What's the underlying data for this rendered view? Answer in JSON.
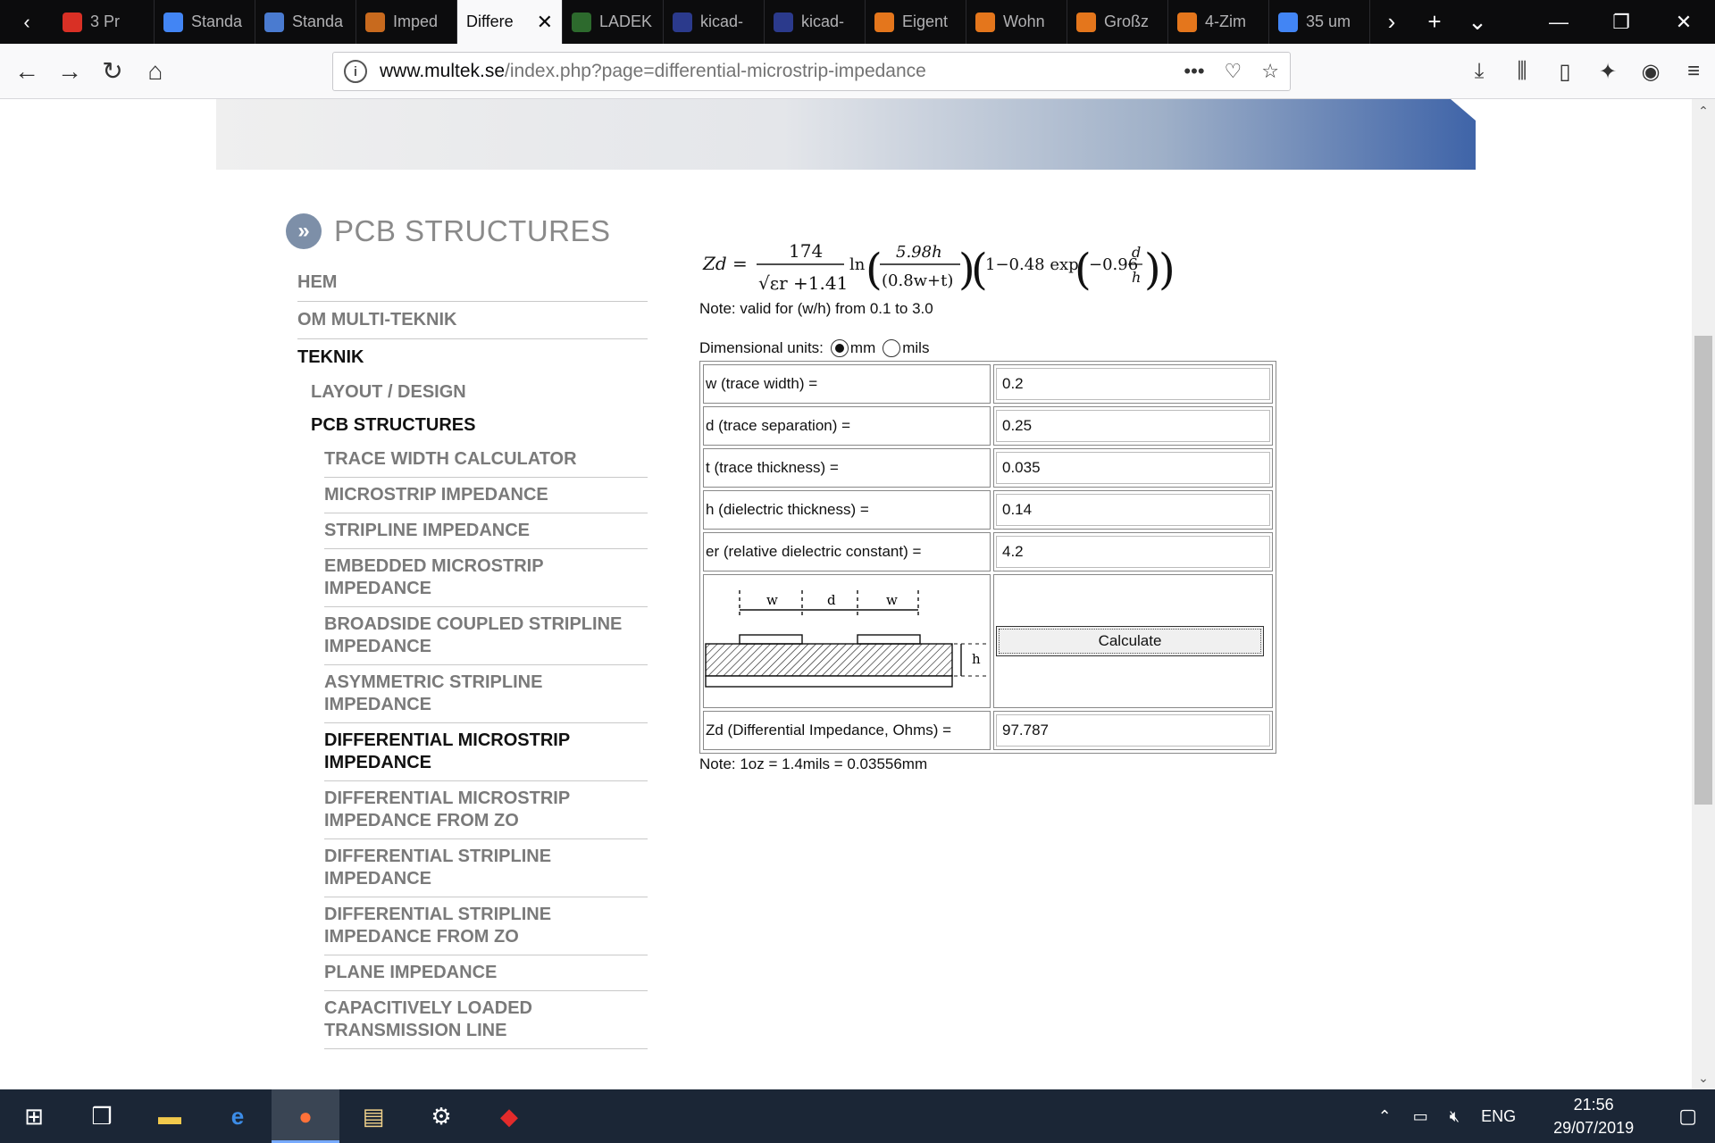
{
  "browser": {
    "tabs": [
      {
        "title": "3 Pr",
        "icon": "gmail-icon",
        "color": "#d93025"
      },
      {
        "title": "Standa",
        "icon": "google-icon",
        "color": "#4285f4"
      },
      {
        "title": "Standa",
        "icon": "globe-icon",
        "color": "#4a7bd0"
      },
      {
        "title": "Imped",
        "icon": "gear-favicon-icon",
        "color": "#c86a1e"
      },
      {
        "title": "Differe",
        "icon": "",
        "color": ""
      },
      {
        "title": "LADEK",
        "icon": "ladek-icon",
        "color": "#2d6a2d"
      },
      {
        "title": "kicad-",
        "icon": "kicad-icon",
        "color": "#2b3a8c"
      },
      {
        "title": "kicad-",
        "icon": "kicad-icon",
        "color": "#2b3a8c"
      },
      {
        "title": "Eigent",
        "icon": "house-icon",
        "color": "#e4761c"
      },
      {
        "title": "Wohn",
        "icon": "house-icon",
        "color": "#e4761c"
      },
      {
        "title": "Großz",
        "icon": "house-icon",
        "color": "#e4761c"
      },
      {
        "title": "4-Zim",
        "icon": "house-icon",
        "color": "#e4761c"
      },
      {
        "title": "35 um",
        "icon": "google-icon",
        "color": "#4285f4"
      }
    ],
    "url_host": "www.multek.se",
    "url_path": "/index.php?page=differential-microstrip-impedance"
  },
  "page": {
    "section_title": "PCB STRUCTURES",
    "menu": [
      {
        "label": "HEM",
        "level": 1,
        "current": false
      },
      {
        "label": "OM MULTI-TEKNIK",
        "level": 1,
        "current": false
      },
      {
        "label": "TEKNIK",
        "level": 1,
        "current": true
      },
      {
        "label": "LAYOUT / DESIGN",
        "level": 2,
        "current": false
      },
      {
        "label": "PCB STRUCTURES",
        "level": 2,
        "current": true
      },
      {
        "label": "TRACE WIDTH CALCULATOR",
        "level": 3,
        "current": false
      },
      {
        "label": "MICROSTRIP IMPEDANCE",
        "level": 3,
        "current": false
      },
      {
        "label": "STRIPLINE IMPEDANCE",
        "level": 3,
        "current": false
      },
      {
        "label": "EMBEDDED MICROSTRIP IMPEDANCE",
        "level": 3,
        "current": false
      },
      {
        "label": "BROADSIDE COUPLED STRIPLINE IMPEDANCE",
        "level": 3,
        "current": false
      },
      {
        "label": "ASYMMETRIC STRIPLINE IMPEDANCE",
        "level": 3,
        "current": false
      },
      {
        "label": "DIFFERENTIAL MICROSTRIP IMPEDANCE",
        "level": 3,
        "current": true
      },
      {
        "label": "DIFFERENTIAL MICROSTRIP IMPEDANCE FROM ZO",
        "level": 3,
        "current": false
      },
      {
        "label": "DIFFERENTIAL STRIPLINE IMPEDANCE",
        "level": 3,
        "current": false
      },
      {
        "label": "DIFFERENTIAL STRIPLINE IMPEDANCE FROM ZO",
        "level": 3,
        "current": false
      },
      {
        "label": "PLANE IMPEDANCE",
        "level": 3,
        "current": false
      },
      {
        "label": "CAPACITIVELY LOADED TRANSMISSION LINE",
        "level": 3,
        "current": false
      }
    ],
    "formula": {
      "lhs": "Zd =",
      "num1": "174",
      "den1": "√εr +1.41",
      "ln": "ln",
      "num2": "5.98h",
      "den2": "(0.8w+t)",
      "factor": "1−0.48 exp",
      "exp_coef": "−0.96",
      "frac_num": "d",
      "frac_den": "h"
    },
    "note_valid": "Note: valid for (w/h) from 0.1 to 3.0",
    "units_label": "Dimensional units:",
    "unit_mm": "mm",
    "unit_mils": "mils",
    "rows": [
      {
        "label": "w (trace width) =",
        "value": "0.2"
      },
      {
        "label": "d (trace separation) =",
        "value": "0.25"
      },
      {
        "label": "t (trace thickness) =",
        "value": "0.035"
      },
      {
        "label": "h (dielectric thickness) =",
        "value": "0.14"
      },
      {
        "label": "er (relative dielectric constant) =",
        "value": "4.2"
      }
    ],
    "diagram_labels": {
      "w": "w",
      "d": "d",
      "h": "h"
    },
    "calculate_label": "Calculate",
    "result_label": "Zd (Differential Impedance, Ohms) =",
    "result_value": "97.787",
    "note_oz": "Note: 1oz = 1.4mils = 0.03556mm"
  },
  "taskbar": {
    "language": "ENG",
    "time": "21:56",
    "date": "29/07/2019"
  }
}
